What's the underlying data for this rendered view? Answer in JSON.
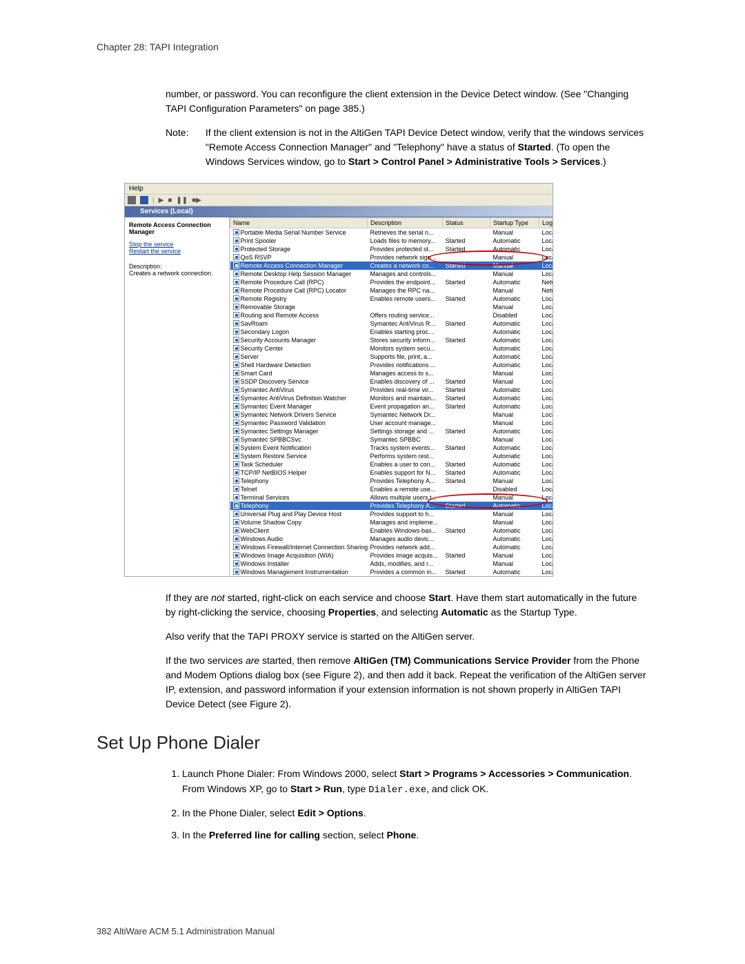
{
  "chapter_header": "Chapter 28:  TAPI Integration",
  "para1_a": "number, or password. You can reconfigure the client extension in the Device Detect window. (See \"Changing TAPI Configuration Parameters\" on page 385.)",
  "note": {
    "label": "Note:",
    "body_a": "If the client extension is not in the AltiGen TAPI Device Detect window, verify that the windows services \"Remote Access Connection Manager\" and \"Telephony\" have a status of ",
    "body_b": "Started",
    "body_c": ". (To open the Windows Services window, go to ",
    "body_d": "Start > Control Panel > Administrative Tools > Services",
    "body_e": ".)"
  },
  "screenshot": {
    "menu_help": "Help",
    "node_header": "Services (Local)",
    "left": {
      "title": "Remote Access Connection Manager",
      "stop": "Stop the service",
      "restart": "Restart the service",
      "desc_label": "Description:",
      "desc_text": "Creates a network connection."
    },
    "cols": {
      "name": "Name",
      "desc": "Description",
      "status": "Status",
      "startup": "Startup Type",
      "logon": "Log On"
    },
    "rows": [
      {
        "n": "Portable Media Serial Number Service",
        "d": "Retrieves the serial n...",
        "s": "",
        "t": "Manual",
        "l": "Local S"
      },
      {
        "n": "Print Spooler",
        "d": "Loads files to memory...",
        "s": "Started",
        "t": "Automatic",
        "l": "Local S"
      },
      {
        "n": "Protected Storage",
        "d": "Provides protected st...",
        "s": "Started",
        "t": "Automatic",
        "l": "Local S"
      },
      {
        "n": "QoS RSVP",
        "d": "Provides network sign...",
        "s": "",
        "t": "Manual",
        "l": "Local S"
      },
      {
        "n": "Remote Access Connection Manager",
        "d": "Creates a network co...",
        "s": "Started",
        "t": "Manual",
        "l": "Local S",
        "hl": true
      },
      {
        "n": "Remote Desktop Help Session Manager",
        "d": "Manages and controls...",
        "s": "",
        "t": "Manual",
        "l": "Local S"
      },
      {
        "n": "Remote Procedure Call (RPC)",
        "d": "Provides the endpoint...",
        "s": "Started",
        "t": "Automatic",
        "l": "Networ"
      },
      {
        "n": "Remote Procedure Call (RPC) Locator",
        "d": "Manages the RPC na...",
        "s": "",
        "t": "Manual",
        "l": "Networ"
      },
      {
        "n": "Remote Registry",
        "d": "Enables remote users...",
        "s": "Started",
        "t": "Automatic",
        "l": "Local S"
      },
      {
        "n": "Removable Storage",
        "d": "",
        "s": "",
        "t": "Manual",
        "l": "Local S"
      },
      {
        "n": "Routing and Remote Access",
        "d": "Offers routing service...",
        "s": "",
        "t": "Disabled",
        "l": "Local S"
      },
      {
        "n": "SavRoam",
        "d": "Symantec AntiVirus R...",
        "s": "Started",
        "t": "Automatic",
        "l": "Local S"
      },
      {
        "n": "Secondary Logon",
        "d": "Enables starting proc...",
        "s": "",
        "t": "Automatic",
        "l": "Local S"
      },
      {
        "n": "Security Accounts Manager",
        "d": "Stores security inform...",
        "s": "Started",
        "t": "Automatic",
        "l": "Local S"
      },
      {
        "n": "Security Center",
        "d": "Monitors system secu...",
        "s": "",
        "t": "Automatic",
        "l": "Local S"
      },
      {
        "n": "Server",
        "d": "Supports file, print, a...",
        "s": "",
        "t": "Automatic",
        "l": "Local S"
      },
      {
        "n": "Shell Hardware Detection",
        "d": "Provides notifications ...",
        "s": "",
        "t": "Automatic",
        "l": "Local S"
      },
      {
        "n": "Smart Card",
        "d": "Manages access to s...",
        "s": "",
        "t": "Manual",
        "l": "Local S"
      },
      {
        "n": "SSDP Discovery Service",
        "d": "Enables discovery of ...",
        "s": "Started",
        "t": "Manual",
        "l": "Local S"
      },
      {
        "n": "Symantec AntiVirus",
        "d": "Provides real-time vir...",
        "s": "Started",
        "t": "Automatic",
        "l": "Local S"
      },
      {
        "n": "Symantec AntiVirus Definition Watcher",
        "d": "Monitors and maintain...",
        "s": "Started",
        "t": "Automatic",
        "l": "Local S"
      },
      {
        "n": "Symantec Event Manager",
        "d": "Event propagation an...",
        "s": "Started",
        "t": "Automatic",
        "l": "Local S"
      },
      {
        "n": "Symantec Network Drivers Service",
        "d": "Symantec Network Dr...",
        "s": "",
        "t": "Manual",
        "l": "Local S"
      },
      {
        "n": "Symantec Password Validation",
        "d": "User account manage...",
        "s": "",
        "t": "Manual",
        "l": "Local S"
      },
      {
        "n": "Symantec Settings Manager",
        "d": "Settings storage and ...",
        "s": "Started",
        "t": "Automatic",
        "l": "Local S"
      },
      {
        "n": "Symantec SPBBCSvc",
        "d": "Symantec SPBBC",
        "s": "",
        "t": "Manual",
        "l": "Local S"
      },
      {
        "n": "System Event Notification",
        "d": "Tracks system events...",
        "s": "Started",
        "t": "Automatic",
        "l": "Local S"
      },
      {
        "n": "System Restore Service",
        "d": "Performs system rest...",
        "s": "",
        "t": "Automatic",
        "l": "Local S"
      },
      {
        "n": "Task Scheduler",
        "d": "Enables a user to con...",
        "s": "Started",
        "t": "Automatic",
        "l": "Local S"
      },
      {
        "n": "TCP/IP NetBIOS Helper",
        "d": "Enables support for N...",
        "s": "Started",
        "t": "Automatic",
        "l": "Local S"
      },
      {
        "n": "Telephony",
        "d": "Provides Telephony A...",
        "s": "Started",
        "t": "Manual",
        "l": "Local S"
      },
      {
        "n": "Telnet",
        "d": "Enables a remote use...",
        "s": "",
        "t": "Disabled",
        "l": "Local S"
      },
      {
        "n": "Terminal Services",
        "d": "Allows multiple users t...",
        "s": "",
        "t": "Manual",
        "l": "Local S"
      },
      {
        "n": "Telephony",
        "d": "Provides Telephony A...",
        "s": "Started",
        "t": "Automatic",
        "l": "Local Sy",
        "hl": true
      },
      {
        "n": "Universal Plug and Play Device Host",
        "d": "Provides support to h...",
        "s": "",
        "t": "Manual",
        "l": "Local S"
      },
      {
        "n": "Volume Shadow Copy",
        "d": "Manages and impleme...",
        "s": "",
        "t": "Manual",
        "l": "Local S"
      },
      {
        "n": "WebClient",
        "d": "Enables Windows-bas...",
        "s": "Started",
        "t": "Automatic",
        "l": "Local S"
      },
      {
        "n": "Windows Audio",
        "d": "Manages audio devic...",
        "s": "",
        "t": "Automatic",
        "l": "Local S"
      },
      {
        "n": "Windows Firewall/Internet Connection Sharing (ICS)",
        "d": "Provides network add...",
        "s": "",
        "t": "Automatic",
        "l": "Local S"
      },
      {
        "n": "Windows Image Acquisition (WIA)",
        "d": "Provides image acquis...",
        "s": "Started",
        "t": "Manual",
        "l": "Local S"
      },
      {
        "n": "Windows Installer",
        "d": "Adds, modifies, and r...",
        "s": "",
        "t": "Manual",
        "l": "Local S"
      },
      {
        "n": "Windows Management Instrumentation",
        "d": "Provides a common in...",
        "s": "Started",
        "t": "Automatic",
        "l": "Local S"
      }
    ]
  },
  "para2": {
    "a": "If they are ",
    "b": "not",
    "c": " started, right-click on each service and choose ",
    "d": "Start",
    "e": ". Have them start automatically in the future by right-clicking the service, choosing ",
    "f": "Properties",
    "g": ", and selecting ",
    "h": "Automatic",
    "i": " as the Startup Type."
  },
  "para3": "Also verify that the TAPI PROXY service is started on the AltiGen server.",
  "para4": {
    "a": "If the two services ",
    "b": "are",
    "c": " started, then remove ",
    "d": "AltiGen (TM) Communications Service Provider",
    "e": " from the Phone and Modem Options dialog box (see Figure 2), and then add it back. Repeat the verification of the AltiGen server IP, extension, and password information if your extension information is not shown properly in AltiGen TAPI Device Detect (see Figure 2)."
  },
  "section_heading": "Set Up Phone Dialer",
  "steps": {
    "s1": {
      "a": "Launch Phone Dialer: From Windows 2000, select ",
      "b": "Start > Programs > Accessories > Communication",
      "c": ". From Windows XP, go to ",
      "d": "Start > Run",
      "e": ", type ",
      "f": "Dialer.exe",
      "g": ", and click OK."
    },
    "s2": {
      "a": "In the Phone Dialer, select ",
      "b": "Edit > Options",
      "c": "."
    },
    "s3": {
      "a": "In the ",
      "b": "Preferred line for calling",
      "c": " section, select ",
      "d": "Phone",
      "e": "."
    }
  },
  "footer": "382   AltiWare ACM 5.1 Administration Manual"
}
